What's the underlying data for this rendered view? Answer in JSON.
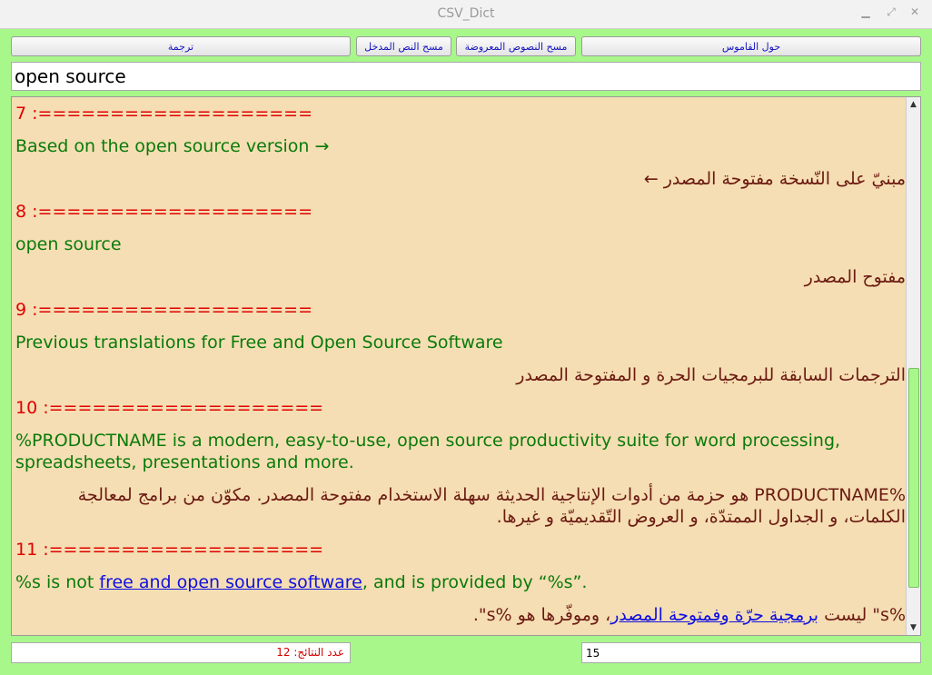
{
  "window": {
    "title": "CSV_Dict"
  },
  "toolbar": {
    "translate": "ترجمة",
    "clear_input": "مسح النص المدخل",
    "clear_output": "مسح النصوص المعروضة",
    "about": "حول القاموس"
  },
  "search": {
    "value": "open source"
  },
  "entries": [
    {
      "header": "7 :===================",
      "en": "Based on the open source version →",
      "ar": "مبنيّ على النّسخة مفتوحة المصدر ←"
    },
    {
      "header": "8 :===================",
      "en": "open source",
      "ar": "مفتوح المصدر"
    },
    {
      "header": "9 :===================",
      "en": "Previous translations for Free and Open Source Software",
      "ar": "الترجمات السابقة للبرمجيات الحرة و المفتوحة المصدر"
    },
    {
      "header": "10 :===================",
      "en": "%PRODUCTNAME is a modern, easy-to-use, open source productivity suite for word processing, spreadsheets, presentations and more.",
      "ar": "%PRODUCTNAME هو حزمة من أدوات الإنتاجية الحديثة سهلة الاستخدام مفتوحة المصدر. مكوّن من برامج لمعالجة الكلمات، و الجداول الممتدّة، و العروض التّقديميّة و غيرها."
    },
    {
      "header": "11 :===================",
      "en_pre": "%s is not ",
      "en_link": "free and open source software",
      "en_post": ", and is provided by “%s”.",
      "ar_pre": "%s\" ليست ",
      "ar_link": "برمجية حرّة وفمتوحة المصدر",
      "ar_post": "، وموفّرها هو %s\"."
    }
  ],
  "status": {
    "results_count": "عدد النتائج: 12",
    "limit": "15"
  },
  "colors": {
    "background": "#a8f78a",
    "panel": "#f5deb3",
    "header": "#e00000",
    "english": "#0a7a0a",
    "arabic": "#6b1a12",
    "link": "#1010e0"
  }
}
